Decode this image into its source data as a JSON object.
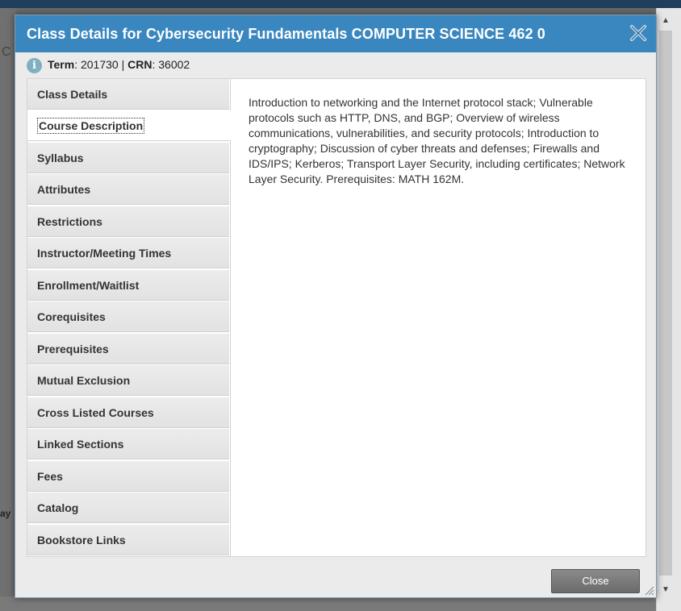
{
  "dialog": {
    "title": "Class Details for Cybersecurity Fundamentals COMPUTER SCIENCE 462 0",
    "info": {
      "term_label": "Term",
      "term_value": "201730",
      "separator": "|",
      "crn_label": "CRN",
      "crn_value": "36002"
    },
    "tabs": [
      {
        "label": "Class Details"
      },
      {
        "label": "Course Description",
        "active": true
      },
      {
        "label": "Syllabus"
      },
      {
        "label": "Attributes"
      },
      {
        "label": "Restrictions"
      },
      {
        "label": "Instructor/Meeting Times"
      },
      {
        "label": "Enrollment/Waitlist"
      },
      {
        "label": "Corequisites"
      },
      {
        "label": "Prerequisites"
      },
      {
        "label": "Mutual Exclusion"
      },
      {
        "label": "Cross Listed Courses"
      },
      {
        "label": "Linked Sections"
      },
      {
        "label": "Fees"
      },
      {
        "label": "Catalog"
      },
      {
        "label": "Bookstore Links"
      }
    ],
    "description": "Introduction to networking and the Internet protocol stack; Vulnerable protocols such as HTTP, DNS, and BGP; Overview of wireless communications, vulnerabilities, and security protocols; Introduction to cryptography; Discussion of cyber threats and defenses; Firewalls and IDS/IPS; Kerberos; Transport Layer Security, including certificates; Network Layer Security. Prerequisites: MATH 162M.",
    "close_label": "Close"
  },
  "background": {
    "left_fragment": "C",
    "left_fragment_2": "ay"
  },
  "colors": {
    "titlebar": "#3a87c0",
    "close_button": "#6b6b6b"
  }
}
